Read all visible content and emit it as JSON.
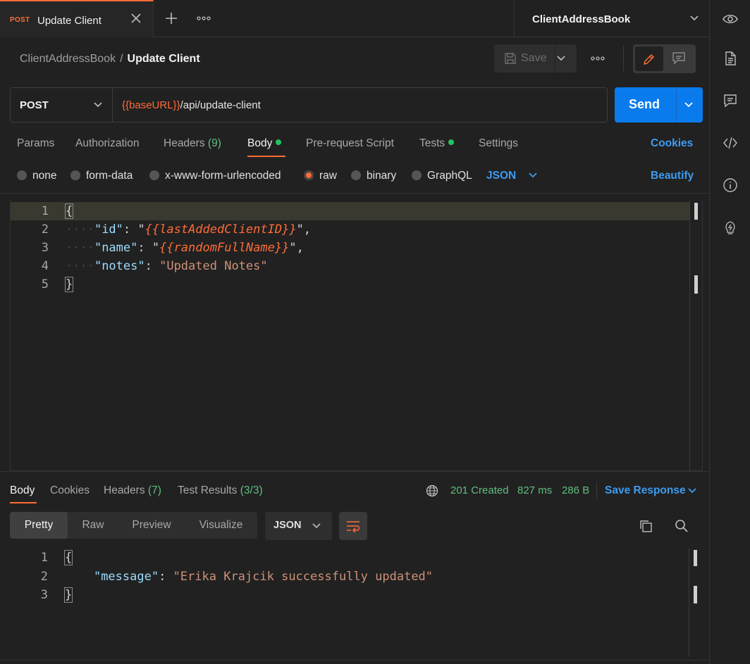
{
  "tab": {
    "method": "POST",
    "title": "Update Client"
  },
  "environment": {
    "name": "ClientAddressBook"
  },
  "breadcrumb": {
    "parent": "ClientAddressBook",
    "separator": "/",
    "current": "Update Client"
  },
  "toolbar": {
    "save_label": "Save"
  },
  "request": {
    "method": "POST",
    "url_var": "{{baseURL}}",
    "url_path": "/api/update-client",
    "send_label": "Send"
  },
  "request_tabs": {
    "params": "Params",
    "authorization": "Authorization",
    "headers": "Headers",
    "headers_count": "(9)",
    "body": "Body",
    "prerequest": "Pre-request Script",
    "tests": "Tests",
    "settings": "Settings",
    "cookies": "Cookies"
  },
  "body_types": {
    "none": "none",
    "form_data": "form-data",
    "urlencoded": "x-www-form-urlencoded",
    "raw": "raw",
    "binary": "binary",
    "graphql": "GraphQL",
    "language": "JSON",
    "beautify": "Beautify"
  },
  "editor": {
    "line_numbers": [
      "1",
      "2",
      "3",
      "4",
      "5"
    ],
    "open_brace": "{",
    "close_brace": "}",
    "key_id": "\"id\"",
    "val_id": "{{lastAddedClientID}}",
    "key_name": "\"name\"",
    "val_name": "{{randomFullName}}",
    "key_notes": "\"notes\"",
    "val_notes": "\"Updated Notes\""
  },
  "response_tabs": {
    "body": "Body",
    "cookies": "Cookies",
    "headers": "Headers",
    "headers_count": "(7)",
    "test_results": "Test Results",
    "test_results_count": "(3/3)"
  },
  "response_status": {
    "status": "201 Created",
    "time": "827 ms",
    "size": "286 B",
    "save_response": "Save Response"
  },
  "response_view": {
    "pretty": "Pretty",
    "raw": "Raw",
    "preview": "Preview",
    "visualize": "Visualize",
    "format": "JSON"
  },
  "response_body": {
    "line_numbers": [
      "1",
      "2",
      "3"
    ],
    "open_brace": "{",
    "close_brace": "}",
    "key_message": "\"message\"",
    "val_message": "\"Erika Krajcik successfully updated\""
  },
  "colors": {
    "accent": "#ff6c37",
    "primary": "#097bed",
    "link": "#3d9bf0",
    "success": "#5fbf7f"
  },
  "icons": [
    "close-icon",
    "plus-icon",
    "more-icon",
    "chevron-down-icon",
    "eye-icon",
    "document-icon",
    "comment-icon",
    "code-icon",
    "info-icon",
    "lightbulb-icon",
    "save-icon",
    "pencil-icon",
    "globe-icon",
    "wrap-icon",
    "copy-icon",
    "search-icon"
  ]
}
